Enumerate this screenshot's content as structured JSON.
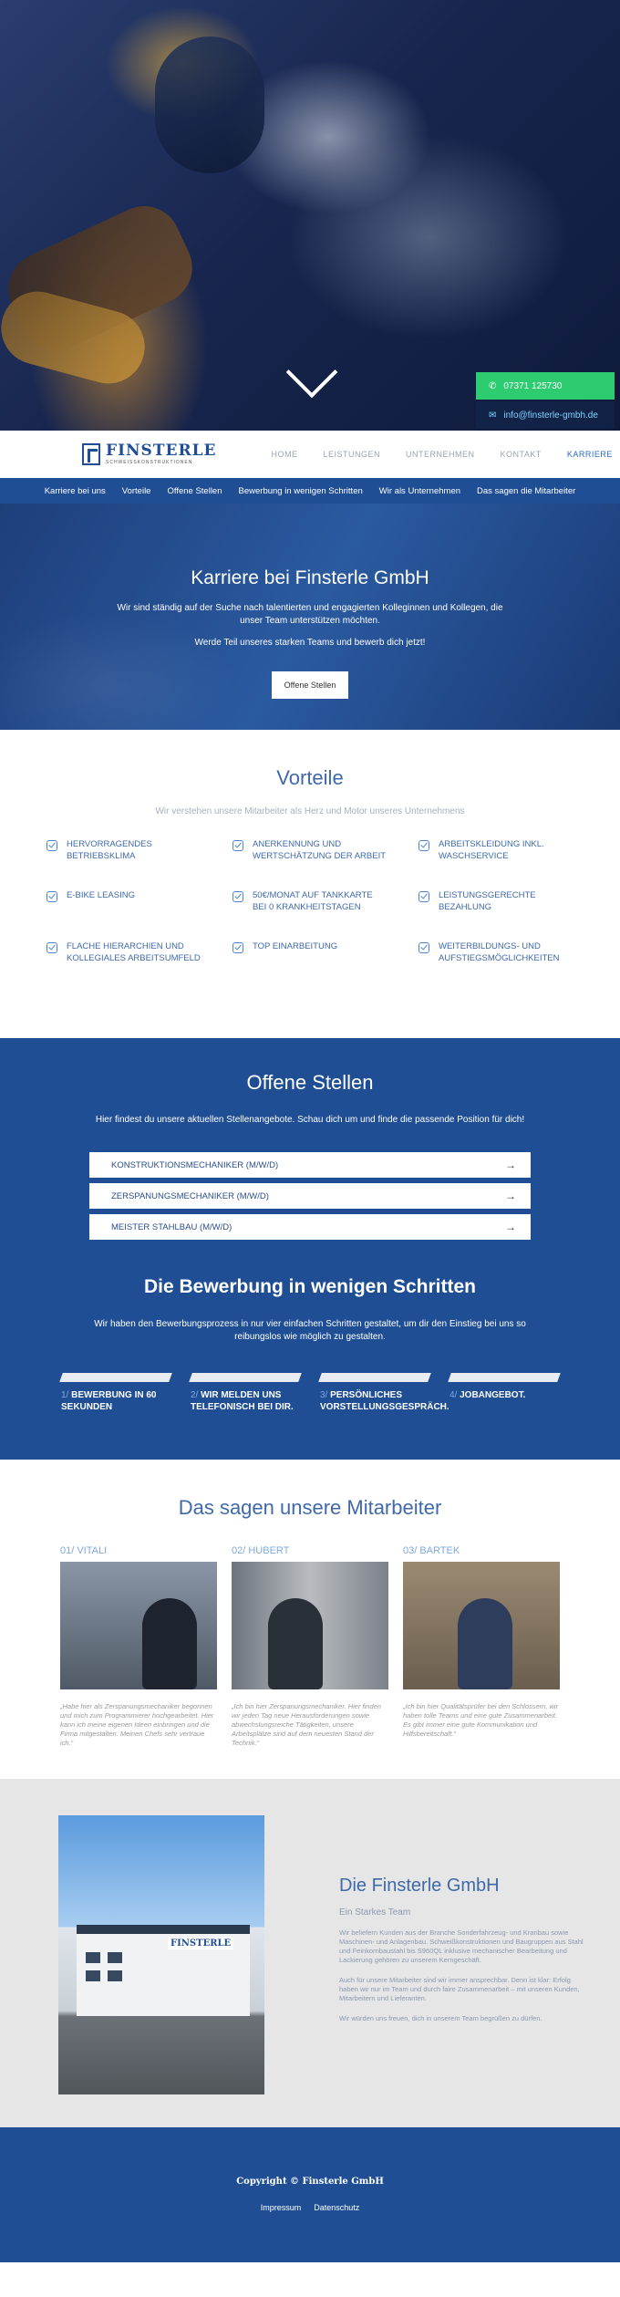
{
  "contact": {
    "phone": "07371 125730",
    "email": "info@finsterle-gmbh.de"
  },
  "logo": {
    "name": "FINSTERLE",
    "subtitle": "SCHWEISSKONSTRUKTIONEN"
  },
  "nav": {
    "items": [
      "HOME",
      "LEISTUNGEN",
      "UNTERNEHMEN",
      "KONTAKT",
      "KARRIERE"
    ],
    "active": "KARRIERE"
  },
  "subnav": [
    "Karriere bei uns",
    "Vorteile",
    "Offene Stellen",
    "Bewerbung in wenigen Schritten",
    "Wir als Unternehmen",
    "Das sagen die Mitarbeiter"
  ],
  "banner": {
    "title": "Karriere bei Finsterle GmbH",
    "text1": "Wir sind ständig auf der Suche nach talentierten und engagierten Kolleginnen und Kollegen, die unser Team unterstützen möchten.",
    "text2": "Werde Teil unseres starken Teams und bewerb dich jetzt!",
    "button": "Offene Stellen"
  },
  "vorteile": {
    "title": "Vorteile",
    "subtitle": "Wir verstehen unsere Mitarbeiter als Herz und Motor unseres Unternehmens",
    "items": [
      "HERVORRAGENDES BETRIEBSKLIMA",
      "ANERKENNUNG UND WERTSCHÄTZUNG DER ARBEIT",
      "ARBEITSKLEIDUNG INKL. WASCHSERVICE",
      "E-BIKE LEASING",
      "50€/MONAT AUF TANKKARTE BEI 0 KRANKHEITSTAGEN",
      "LEISTUNGSGERECHTE BEZAHLUNG",
      "FLACHE HIERARCHIEN UND KOLLEGIALES ARBEITSUMFELD",
      "TOP EINARBEITUNG",
      "WEITERBILDUNGS- UND AUFSTIEGSMÖGLICHKEITEN"
    ]
  },
  "stellen": {
    "title": "Offene Stellen",
    "lead": "Hier findest du unsere aktuellen Stellenangebote. Schau dich um und finde die passende Position für dich!",
    "jobs": [
      "KONSTRUKTIONSMECHANIKER (M/W/D)",
      "ZERSPANUNGSMECHANIKER (M/W/D)",
      "MEISTER STAHLBAU (M/W/D)"
    ]
  },
  "bewerbung": {
    "title": "Die Bewerbung in wenigen Schritten",
    "lead": "Wir haben den Bewerbungsprozess in nur vier einfachen Schritten gestaltet, um dir den Einstieg bei uns so reibungslos wie möglich zu gestalten.",
    "steps": [
      {
        "num": "1/",
        "text": "BEWERBUNG IN 60 SEKUNDEN"
      },
      {
        "num": "2/",
        "text": "WIR MELDEN UNS TELEFONISCH BEI DIR."
      },
      {
        "num": "3/",
        "text": "PERSÖNLICHES VORSTELLUNGSGESPRÄCH."
      },
      {
        "num": "4/",
        "text": "JOBANGEBOT."
      }
    ]
  },
  "mitarbeiter": {
    "title": "Das sagen unsere Mitarbeiter",
    "members": [
      {
        "name": "01/ VITALI",
        "quote": "„Habe hier als Zerspanungsmechaniker begonnen und mich zum Programmierer hochgearbeitet. Hier kann ich meine eigenen Ideen einbringen und die Firma mitgestalten. Meinen Chefs sehr vertraue ich.“"
      },
      {
        "name": "02/ HUBERT",
        "quote": "„Ich bin hier Zerspanungsmechaniker. Hier finden wir jeden Tag neue Herausforderungen sowie abwechslungsreiche Tätigkeiten, unsere Arbeitsplätze sind auf dem neuesten Stand der Technik.“"
      },
      {
        "name": "03/ BARTEK",
        "quote": "„Ich bin hier Qualitätsprüfer bei den Schlossern, wir haben tolle Teams und eine gute Zusammenarbeit. Es gibt immer eine gute Kommunikation und Hilfsbereitschaft.“"
      }
    ]
  },
  "firma": {
    "title": "Die Finsterle GmbH",
    "tagline": "Ein Starkes Team",
    "sign": "FINSTERLE",
    "p1": "Wir beliefern Kunden aus der Branche Sonderfahrzeug- und Kranbau sowie Maschinen- und Anlagenbau. Schweißkonstruktionen und Baugruppen aus Stahl und Feinkornbaustahl bis S960QL inklusive mechanischer Bearbeitung und Lackierung gehören zu unserem Kerngeschäft.",
    "p2": "Auch für unsere Mitarbeiter sind wir immer ansprechbar. Denn ist klar: Erfolg haben wir nur im Team und durch faire Zusammenarbeit – mit unseren Kunden, Mitarbeitern und Lieferanten.",
    "p3": "Wir würden uns freuen, dich in unserem Team begrüßen zu dürfen."
  },
  "footer": {
    "copyright": "Copyright © Finsterle GmbH",
    "links": [
      "Impressum",
      "Datenschutz"
    ]
  }
}
